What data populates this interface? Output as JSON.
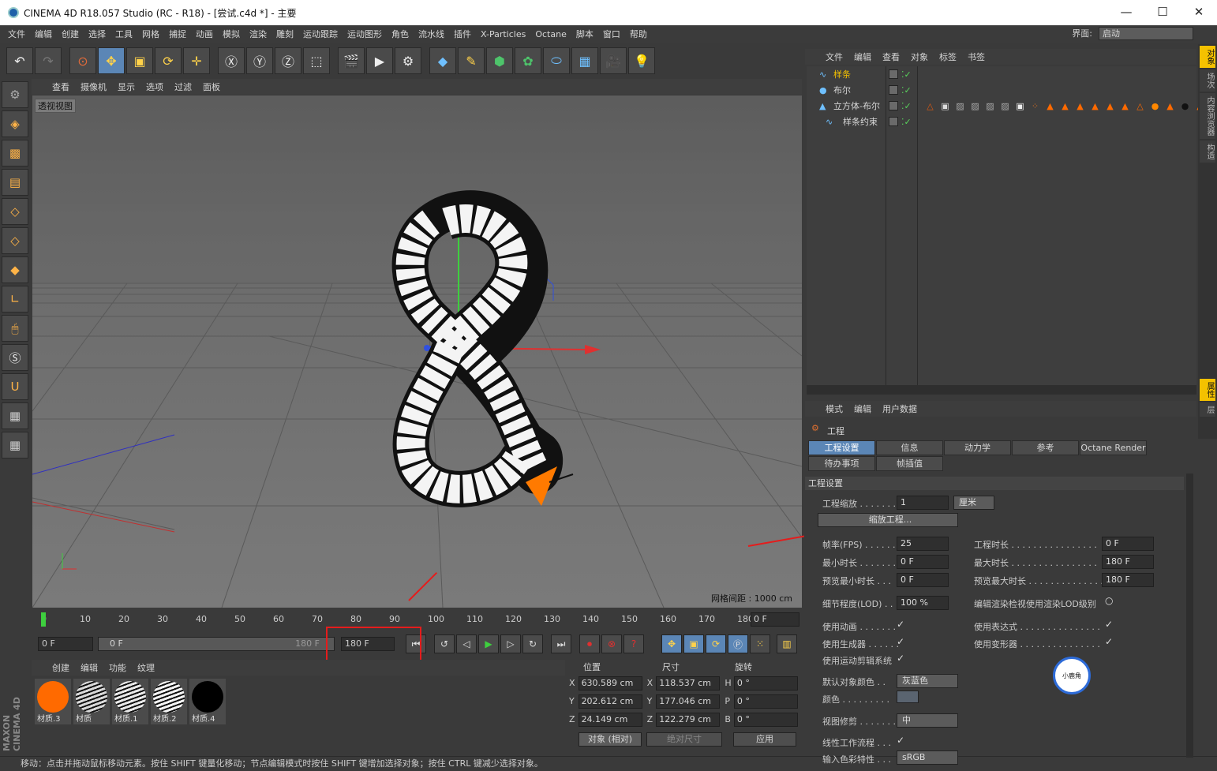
{
  "window": {
    "title": "CINEMA 4D R18.057 Studio (RC - R18) - [尝试.c4d *] - 主要",
    "min": "—",
    "max": "☐",
    "close": "✕"
  },
  "menu": [
    "文件",
    "编辑",
    "创建",
    "选择",
    "工具",
    "网格",
    "捕捉",
    "动画",
    "模拟",
    "渲染",
    "雕刻",
    "运动跟踪",
    "运动图形",
    "角色",
    "流水线",
    "插件",
    "X-Particles",
    "Octane",
    "脚本",
    "窗口",
    "帮助"
  ],
  "interface": {
    "label": "界面:",
    "value": "启动"
  },
  "viewport": {
    "menu": [
      "查看",
      "摄像机",
      "显示",
      "选项",
      "过滤",
      "面板"
    ],
    "label": "透视视图",
    "grid_info": "网格间距 : 1000 cm"
  },
  "timeline": {
    "ticks": [
      "0",
      "10",
      "20",
      "30",
      "40",
      "50",
      "60",
      "70",
      "80",
      "90",
      "100",
      "110",
      "120",
      "130",
      "140",
      "150",
      "160",
      "170",
      "180"
    ],
    "frame": "0 F",
    "current": "0 F",
    "slider_left": "0 F",
    "slider_right": "180 F",
    "end": "180 F"
  },
  "materials": {
    "menu": [
      "创建",
      "编辑",
      "功能",
      "纹理"
    ],
    "items": [
      {
        "name": "材质.3",
        "color": "#ff6a00"
      },
      {
        "name": "材质",
        "color": "#d8d8d8"
      },
      {
        "name": "材质.1",
        "color": "#e8e8e8"
      },
      {
        "name": "材质.2",
        "color": "#f4f4f4"
      },
      {
        "name": "材质.4",
        "color": "#000000"
      }
    ]
  },
  "coords": {
    "headers": [
      "位置",
      "尺寸",
      "旋转"
    ],
    "rows": [
      {
        "a": "X",
        "v1": "630.589 cm",
        "b": "X",
        "v2": "118.537 cm",
        "c": "H",
        "v3": "0 °"
      },
      {
        "a": "Y",
        "v1": "202.612 cm",
        "b": "Y",
        "v2": "177.046 cm",
        "c": "P",
        "v3": "0 °"
      },
      {
        "a": "Z",
        "v1": "24.149 cm",
        "b": "Z",
        "v2": "122.279 cm",
        "c": "B",
        "v3": "0 °"
      }
    ],
    "mode": "对象 (相对)",
    "size_mode": "绝对尺寸",
    "apply": "应用"
  },
  "status": "移动：点击并拖动鼠标移动元素。按住 SHIFT 键量化移动；节点编辑模式时按住 SHIFT 键增加选择对象；按住 CTRL 键减少选择对象。",
  "objects": {
    "menu": [
      "文件",
      "编辑",
      "查看",
      "对象",
      "标签",
      "书签"
    ],
    "items": [
      {
        "name": "样条",
        "color": "#f4c100"
      },
      {
        "name": "布尔",
        "color": "#d6d6d6"
      },
      {
        "name": "立方体-布尔",
        "color": "#d6d6d6"
      },
      {
        "name": "样条约束",
        "color": "#d6d6d6"
      }
    ]
  },
  "attributes": {
    "menu": [
      "模式",
      "编辑",
      "用户数据"
    ],
    "title": "工程",
    "tabs": [
      "工程设置",
      "信息",
      "动力学",
      "参考",
      "Octane Render",
      "待办事项",
      "帧插值"
    ],
    "section": "工程设置",
    "scale_label": "工程缩放 . . . . . . .",
    "scale_value": "1",
    "scale_unit": "厘米",
    "scale_button": "缩放工程...",
    "fps_label": "帧率(FPS) . . . . . .",
    "fps_value": "25",
    "proj_len_label": "工程时长 . . . . . . . . . . . . . . . .",
    "proj_len_value": "0 F",
    "min_label": "最小时长 . . . . . . .",
    "min_value": "0 F",
    "max_label": "最大时长 . . . . . . . . . . . . . . . .",
    "max_value": "180 F",
    "pmin_label": "预览最小时长 . . .",
    "pmin_value": "0 F",
    "pmax_label": "预览最大时长 . . . . . . . . . . . . . .",
    "pmax_value": "180 F",
    "lod_label": "细节程度(LOD) . .",
    "lod_value": "100 %",
    "lod_render": "编辑渲染检视使用渲染LOD级别",
    "anim": "使用动画 . . . . . . .",
    "expr": "使用表达式 . . . . . . . . . . . . . . .",
    "gen": "使用生成器 . . . . . .",
    "deform": "使用变形器 . . . . . . . . . . . . . . .",
    "mograph": "使用运动剪辑系统",
    "defcolor_label": "默认对象颜色 . .",
    "defcolor_value": "灰蓝色",
    "color_label": "颜色 . . . . . . . . .",
    "clip_label": "视图修剪 . . . . . . .",
    "clip_value": "中",
    "linear_label": "线性工作流程 . . .",
    "input_label": "输入色彩特性 . . .",
    "input_value": "sRGB"
  },
  "side_tabs": [
    "对象",
    "场次",
    "内容浏览器",
    "构造"
  ],
  "side_tabs2": [
    "属性",
    "层"
  ],
  "badge": "小鹿角"
}
